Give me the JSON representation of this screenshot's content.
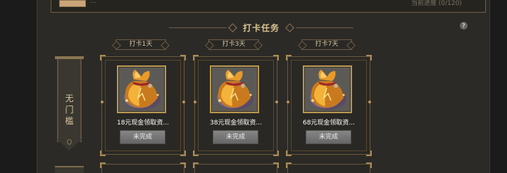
{
  "top": {
    "label": "...",
    "progress": "当前进度 (0/120)"
  },
  "title": "打卡任务",
  "help_icon": "?",
  "banner": {
    "text": "无\n门\n槛"
  },
  "cards": [
    {
      "day": "打卡1天",
      "title": "18元现金领取资...",
      "button": "未完成"
    },
    {
      "day": "打卡3天",
      "title": "38元现金领取资...",
      "button": "未完成"
    },
    {
      "day": "打卡7天",
      "title": "68元现金领取资...",
      "button": "未完成"
    }
  ],
  "colors": {
    "accent_gold": "#d8c394",
    "frame": "#6a5a3f",
    "button": "#7a7a7a"
  },
  "icons": {
    "reward": "money-bag-icon",
    "help": "help-icon"
  }
}
